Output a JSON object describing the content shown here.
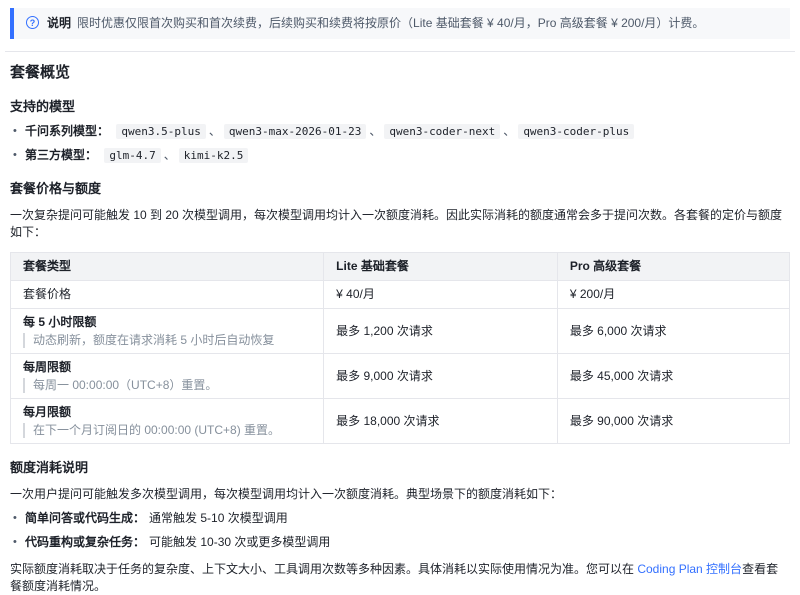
{
  "colors": {
    "accent_blue": "#3370ff",
    "banner_bg": "#f7f8fa",
    "table_header_bg": "#f2f3f5",
    "border": "#e5e6eb",
    "muted_text": "#86909c"
  },
  "separators": {
    "enum": "、"
  },
  "banner": {
    "icon_glyph": "?",
    "label": "说明",
    "text": "限时优惠仅限首次购买和首次续费，后续购买和续费将按原价（Lite 基础套餐 ¥ 40/月，Pro 高级套餐 ¥ 200/月）计费。"
  },
  "overview": {
    "title": "套餐概览"
  },
  "models": {
    "title": "支持的模型",
    "items": [
      {
        "label": "千问系列模型：",
        "codes": [
          "qwen3.5-plus",
          "qwen3-max-2026-01-23",
          "qwen3-coder-next",
          "qwen3-coder-plus"
        ]
      },
      {
        "label": "第三方模型：",
        "codes": [
          "glm-4.7",
          "kimi-k2.5"
        ]
      }
    ]
  },
  "pricing": {
    "title": "套餐价格与额度",
    "intro": "一次复杂提问可能触发 10 到 20 次模型调用，每次模型调用均计入一次额度消耗。因此实际消耗的额度通常会多于提问次数。各套餐的定价与额度如下："
  },
  "table": {
    "headers": [
      "套餐类型",
      "Lite 基础套餐",
      "Pro 高级套餐"
    ],
    "rows": [
      {
        "label": "套餐价格",
        "note": "",
        "lite": "¥ 40/月",
        "pro": "¥ 200/月"
      },
      {
        "label": "每 5 小时限额",
        "note": "动态刷新，额度在请求消耗 5 小时后自动恢复",
        "lite": "最多 1,200 次请求",
        "pro": "最多 6,000 次请求"
      },
      {
        "label": "每周限额",
        "note": "每周一 00:00:00（UTC+8）重置。",
        "lite": "最多 9,000 次请求",
        "pro": "最多 45,000 次请求"
      },
      {
        "label": "每月限额",
        "note": "在下一个月订阅日的 00:00:00 (UTC+8) 重置。",
        "lite": "最多 18,000 次请求",
        "pro": "最多 90,000 次请求"
      }
    ]
  },
  "consumption": {
    "title": "额度消耗说明",
    "intro": "一次用户提问可能触发多次模型调用，每次模型调用均计入一次额度消耗。典型场景下的额度消耗如下：",
    "items": [
      {
        "label": "简单问答或代码生成：",
        "text": "通常触发 5-10 次模型调用"
      },
      {
        "label": "代码重构或复杂任务：",
        "text": "可能触发 10-30 次或更多模型调用"
      }
    ],
    "footer": {
      "before": "实际额度消耗取决于任务的复杂度、上下文大小、工具调用次数等多种因素。具体消耗以实际使用情况为准。您可以在 ",
      "link": "Coding Plan 控制台",
      "after": "查看套餐额度消耗情况。"
    }
  }
}
